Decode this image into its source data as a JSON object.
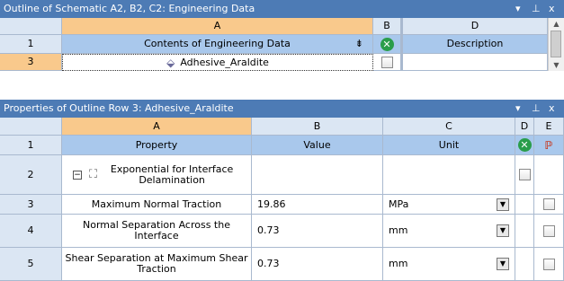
{
  "outline": {
    "title": "Outline of Schematic A2, B2, C2: Engineering Data",
    "col_headers": [
      "A",
      "B",
      "D"
    ],
    "rows": [
      {
        "num": "1",
        "a": "Contents of Engineering Data",
        "d": "Description"
      },
      {
        "num": "3",
        "a": "Adhesive_Araldite",
        "d": ""
      }
    ]
  },
  "properties": {
    "title": "Properties of Outline Row 3: Adhesive_Araldite",
    "col_headers": [
      "A",
      "B",
      "C",
      "D",
      "E"
    ],
    "header_row": {
      "num": "1",
      "property": "Property",
      "value": "Value",
      "unit": "Unit"
    },
    "rows": [
      {
        "num": "2",
        "property": "Exponential for Interface Delamination",
        "value": "",
        "unit": ""
      },
      {
        "num": "3",
        "property": "Maximum Normal Traction",
        "value": "19.86",
        "unit": "MPa"
      },
      {
        "num": "4",
        "property": "Normal Separation Across the Interface",
        "value": "0.73",
        "unit": "mm"
      },
      {
        "num": "5",
        "property": "Shear Separation at Maximum Shear Traction",
        "value": "0.73",
        "unit": "mm"
      }
    ]
  },
  "controls": {
    "dropdown": "▾",
    "pin": "ꟼ",
    "close": "x"
  }
}
